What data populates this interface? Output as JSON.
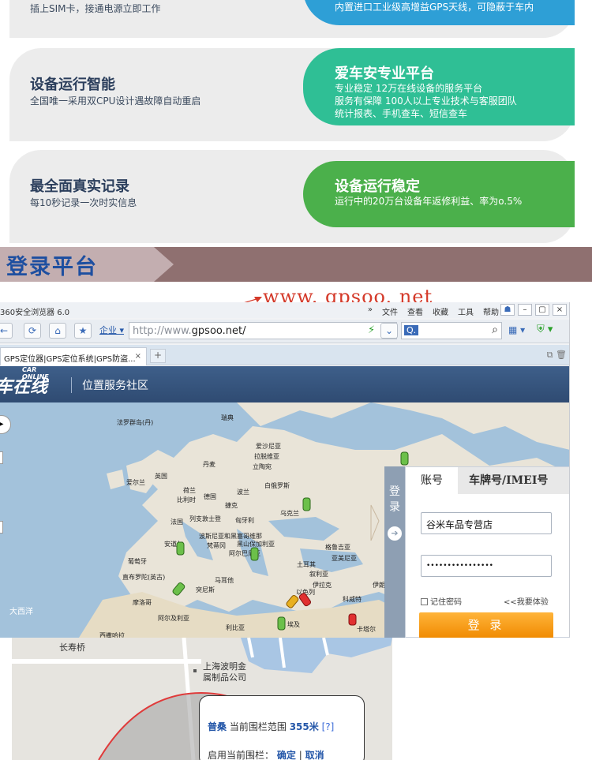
{
  "top_card": {
    "left_sub": "插上SIM卡，接通电源立即工作",
    "right_line": "内置进口工业级高增益GPS天线，可隐蔽于车内",
    "right_color": "#2e9fd6"
  },
  "card2": {
    "left_title": "设备运行智能",
    "left_sub": "全国唯一采用双CPU设计遇故障自动重启",
    "right_title": "爱车安专业平台",
    "right_lines": [
      "专业稳定  12万在线设备的服务平台",
      "服务有保障  100人以上专业技术与客服团队",
      "统计报表、手机查车、短信查车"
    ],
    "right_color": "#2fbf95"
  },
  "card3": {
    "left_title": "最全面真实记录",
    "left_sub": "每10秒记录一次时实信息",
    "right_title": "设备运行稳定",
    "right_line": "运行中的20万台设备年返修利益、率为o.5%",
    "right_color": "#4bb04b"
  },
  "section": {
    "title": "登录平台"
  },
  "annotation": {
    "url_text": "www. gpsoo. net"
  },
  "browser": {
    "app_title": "360安全浏览器 6.0",
    "menus": [
      "»",
      "文件",
      "查看",
      "收藏",
      "工具",
      "帮助"
    ],
    "enterprise_label": "企业",
    "url_prefix": "http://www.",
    "url_domain": "gpsoo.net/",
    "search_label": "Q.",
    "tab_title": "GPS定位器|GPS定位系统|GPS防盗...",
    "site_logo": "车在线",
    "site_logo_en": "CAR ONLINE",
    "site_tagline": "位置服务社区"
  },
  "map_labels": {
    "faroe": "法罗群岛(丹)",
    "sweden": "瑞典",
    "estonia": "爱沙尼亚",
    "latvia": "拉脱维亚",
    "denmark": "丹麦",
    "lithuania": "立陶宛",
    "ireland": "爱尔兰",
    "uk": "英国",
    "netherlands": "荷兰",
    "belgium": "比利时",
    "germany": "德国",
    "poland": "波兰",
    "belarus": "白俄罗斯",
    "czech": "捷克",
    "ukraine": "乌克兰",
    "france": "法国",
    "liechtenstein": "列支敦士登",
    "hungary": "匈牙利",
    "bosnia": "波斯尼亚和黑塞哥维那",
    "andorra": "安道尔",
    "vatican": "梵蒂冈",
    "montenegro": "黑山",
    "bulgaria": "保加利亚",
    "albania": "阿尔巴尼亚",
    "georgia": "格鲁吉亚",
    "portugal": "葡萄牙",
    "armenia": "亚美尼亚",
    "turkey": "土耳其",
    "gibraltar": "直布罗陀(英古)",
    "malta": "马耳他",
    "tunisia": "突尼斯",
    "iraq": "伊拉克",
    "syria": "叙利亚",
    "iran": "伊朗",
    "atlantic": "大西洋",
    "morocco": "摩洛哥",
    "israel": "以色列",
    "algeria": "阿尔及利亚",
    "kuwait": "科威特",
    "libya": "利比亚",
    "egypt": "埃及",
    "qatar": "卡塔尔",
    "western_sahara": "西撒哈拉"
  },
  "login": {
    "side_label": [
      "登",
      "录"
    ],
    "tab_account": "账号",
    "tab_plate": "车牌号/IMEI号",
    "username": "谷米车品专营店",
    "password": "••••••••••••••••",
    "remember": "记住密码",
    "trial": "<<我要体验",
    "submit": "登 录"
  },
  "bottom_map": {
    "road": "长寿桥",
    "company_line1": "上海波明金",
    "company_line2": "属制品公司",
    "popup_name": "普桑",
    "popup_range_label": "当前围栏范围",
    "popup_range_value": "355米",
    "popup_help": "[?]",
    "popup_enable": "启用当前围栏：",
    "popup_confirm": "确定",
    "popup_sep": "|",
    "popup_cancel": "取消"
  }
}
